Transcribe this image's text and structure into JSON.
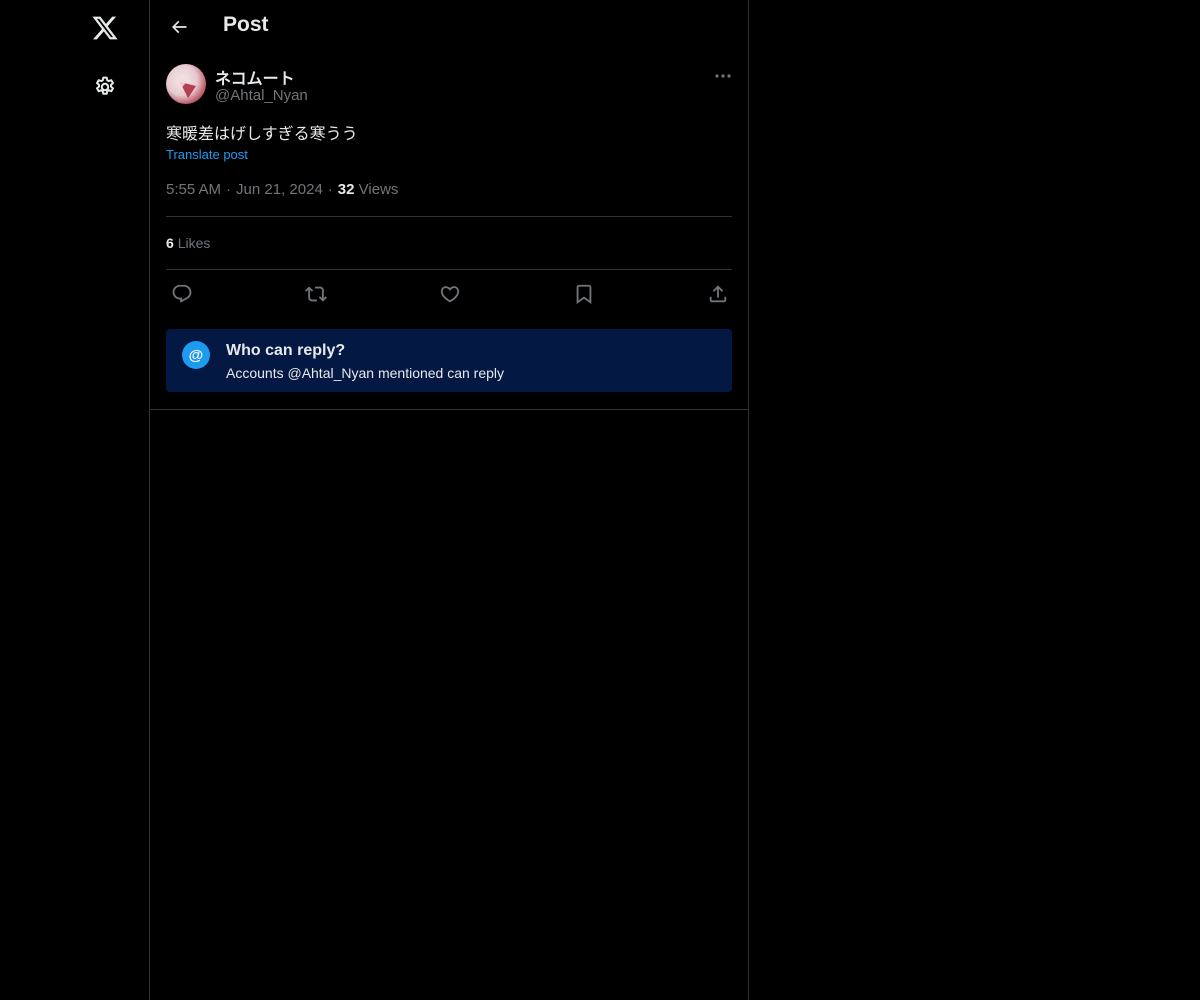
{
  "colors": {
    "background": "#000000",
    "text_primary": "#e7e9ea",
    "text_secondary": "#71767b",
    "accent": "#1d9bf0",
    "reply_card_bg": "#031842",
    "border": "#2f3336"
  },
  "sidebar": {
    "logo_icon": "x-logo-icon",
    "settings_icon": "gear-icon"
  },
  "header": {
    "back_icon": "arrow-left-icon",
    "title": "Post"
  },
  "post": {
    "author_name": "ネコムート",
    "author_handle": "@Ahtal_Nyan",
    "more_icon": "ellipsis-icon",
    "text": "寒暖差はげしすぎる寒うう",
    "translate_label": "Translate post",
    "time": "5:55 AM",
    "date": "Jun 21, 2024",
    "separator": "·",
    "views_count": "32",
    "views_label": "Views",
    "likes_count": "6",
    "likes_label": "Likes"
  },
  "actions": [
    {
      "name": "reply",
      "icon": "comment-icon"
    },
    {
      "name": "repost",
      "icon": "repost-icon"
    },
    {
      "name": "like",
      "icon": "heart-icon"
    },
    {
      "name": "bookmark",
      "icon": "bookmark-icon"
    },
    {
      "name": "share",
      "icon": "share-icon"
    }
  ],
  "reply_restriction": {
    "icon_glyph": "@",
    "title": "Who can reply?",
    "subtitle": "Accounts @Ahtal_Nyan mentioned can reply"
  }
}
